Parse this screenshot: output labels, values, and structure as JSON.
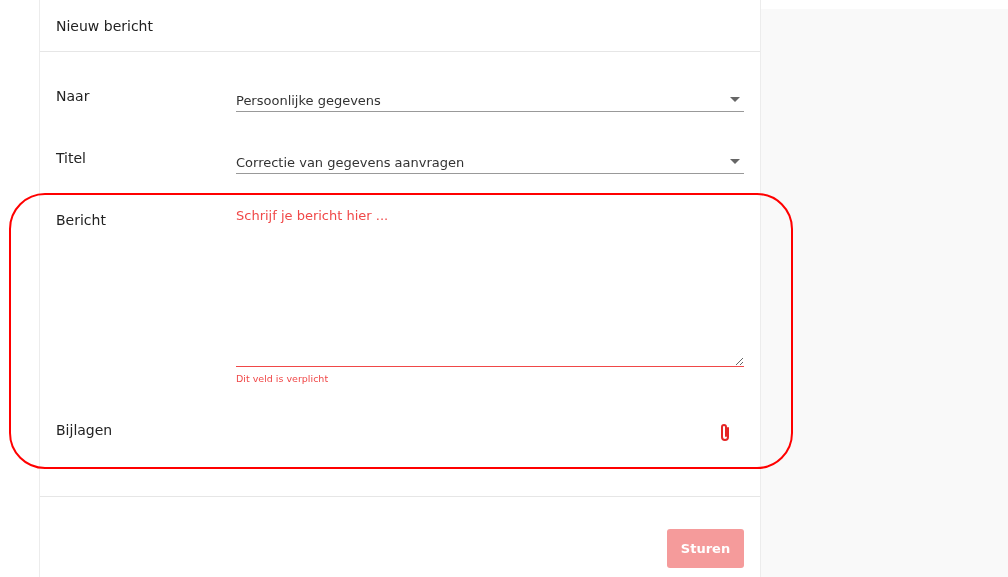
{
  "card": {
    "title": "Nieuw bericht"
  },
  "fields": [
    {
      "kind": "select",
      "label": "Naar",
      "value": "Persoonlijke gegevens"
    },
    {
      "kind": "select",
      "label": "Titel",
      "value": "Correctie van gegevens aanvragen"
    },
    {
      "kind": "textarea",
      "label": "Bericht",
      "placeholder": "Schrijf je bericht hier ...",
      "error": "Dit veld is verplicht"
    },
    {
      "kind": "attachment",
      "label": "Bijlagen"
    }
  ],
  "highlight": true,
  "submit": {
    "label": "Sturen",
    "disabled": true
  }
}
